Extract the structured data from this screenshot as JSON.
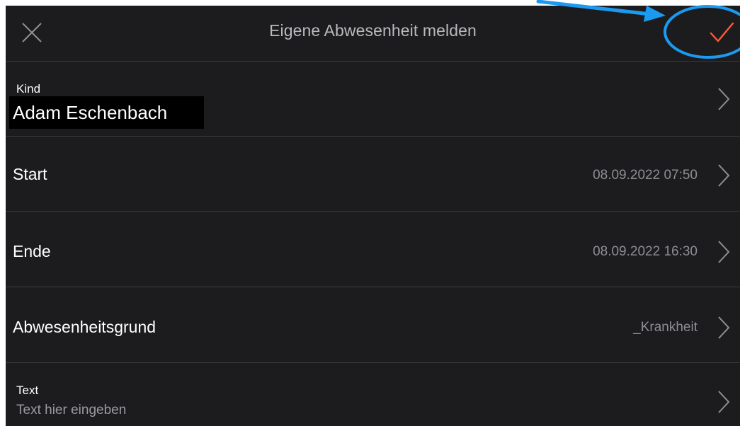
{
  "header": {
    "title": "Eigene Abwesenheit melden",
    "close_icon": "close-icon",
    "confirm_icon": "checkmark-icon",
    "accent_color": "#ff5a36"
  },
  "fields": {
    "kind": {
      "label": "Kind",
      "value": "Adam Eschenbach"
    },
    "start": {
      "label": "Start",
      "value": "08.09.2022 07:50"
    },
    "ende": {
      "label": "Ende",
      "value": "08.09.2022 16:30"
    },
    "grund": {
      "label": "Abwesenheitsgrund",
      "value": "_Krankheit"
    },
    "text": {
      "label": "Text",
      "placeholder": "Text hier eingeben"
    }
  },
  "annotation": {
    "color": "#1a9bf0"
  }
}
